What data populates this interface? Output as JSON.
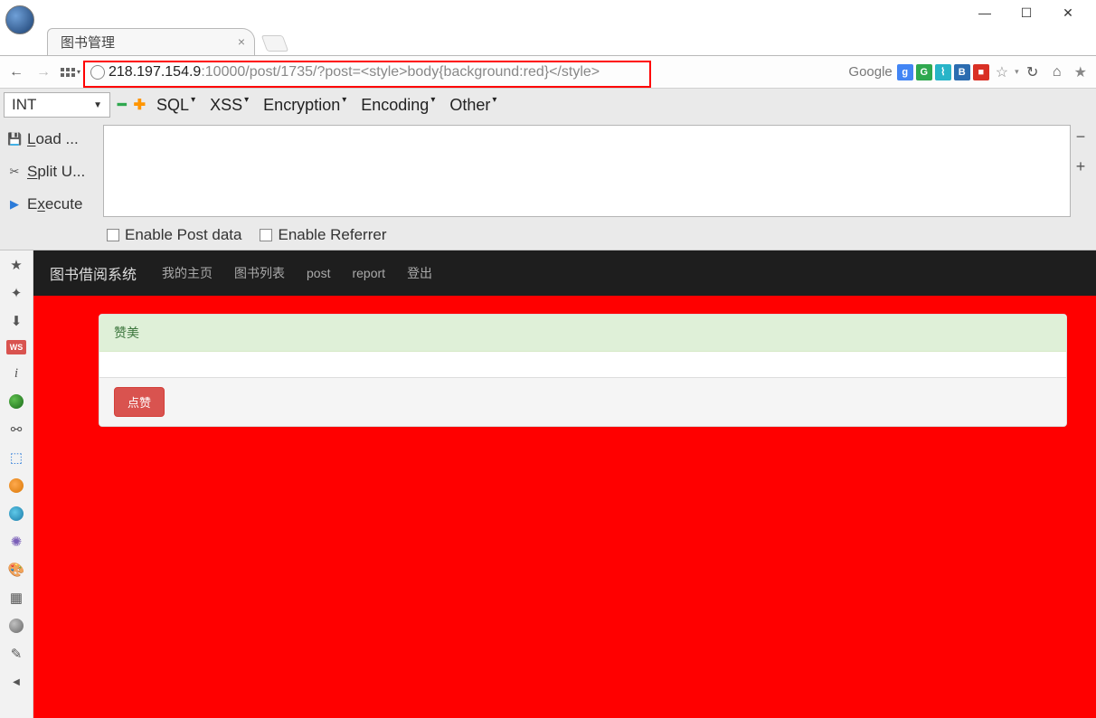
{
  "window": {
    "min": "—",
    "max": "☐",
    "close": "✕"
  },
  "tab": {
    "title": "图书管理"
  },
  "url": {
    "host": "218.197.154.9",
    "rest": ":10000/post/1735/?post=<style>body{background:red}</style>"
  },
  "search": {
    "label": "Google"
  },
  "hackbar": {
    "select": "INT",
    "menus": {
      "sql": "SQL",
      "xss": "XSS",
      "enc": "Encryption",
      "encode": "Encoding",
      "other": "Other"
    },
    "side": {
      "load": "Load ...",
      "split": "Split U...",
      "execute": "Execute",
      "load_key": "L",
      "split_key": "S",
      "exec_key": "x"
    },
    "post": "Enable Post data",
    "referrer": "Enable Referrer"
  },
  "page": {
    "nav": {
      "brand": "图书借阅系统",
      "home": "我的主页",
      "list": "图书列表",
      "post": "post",
      "report": "report",
      "logout": "登出"
    },
    "panel": {
      "title": "赞美",
      "like": "点赞"
    }
  }
}
